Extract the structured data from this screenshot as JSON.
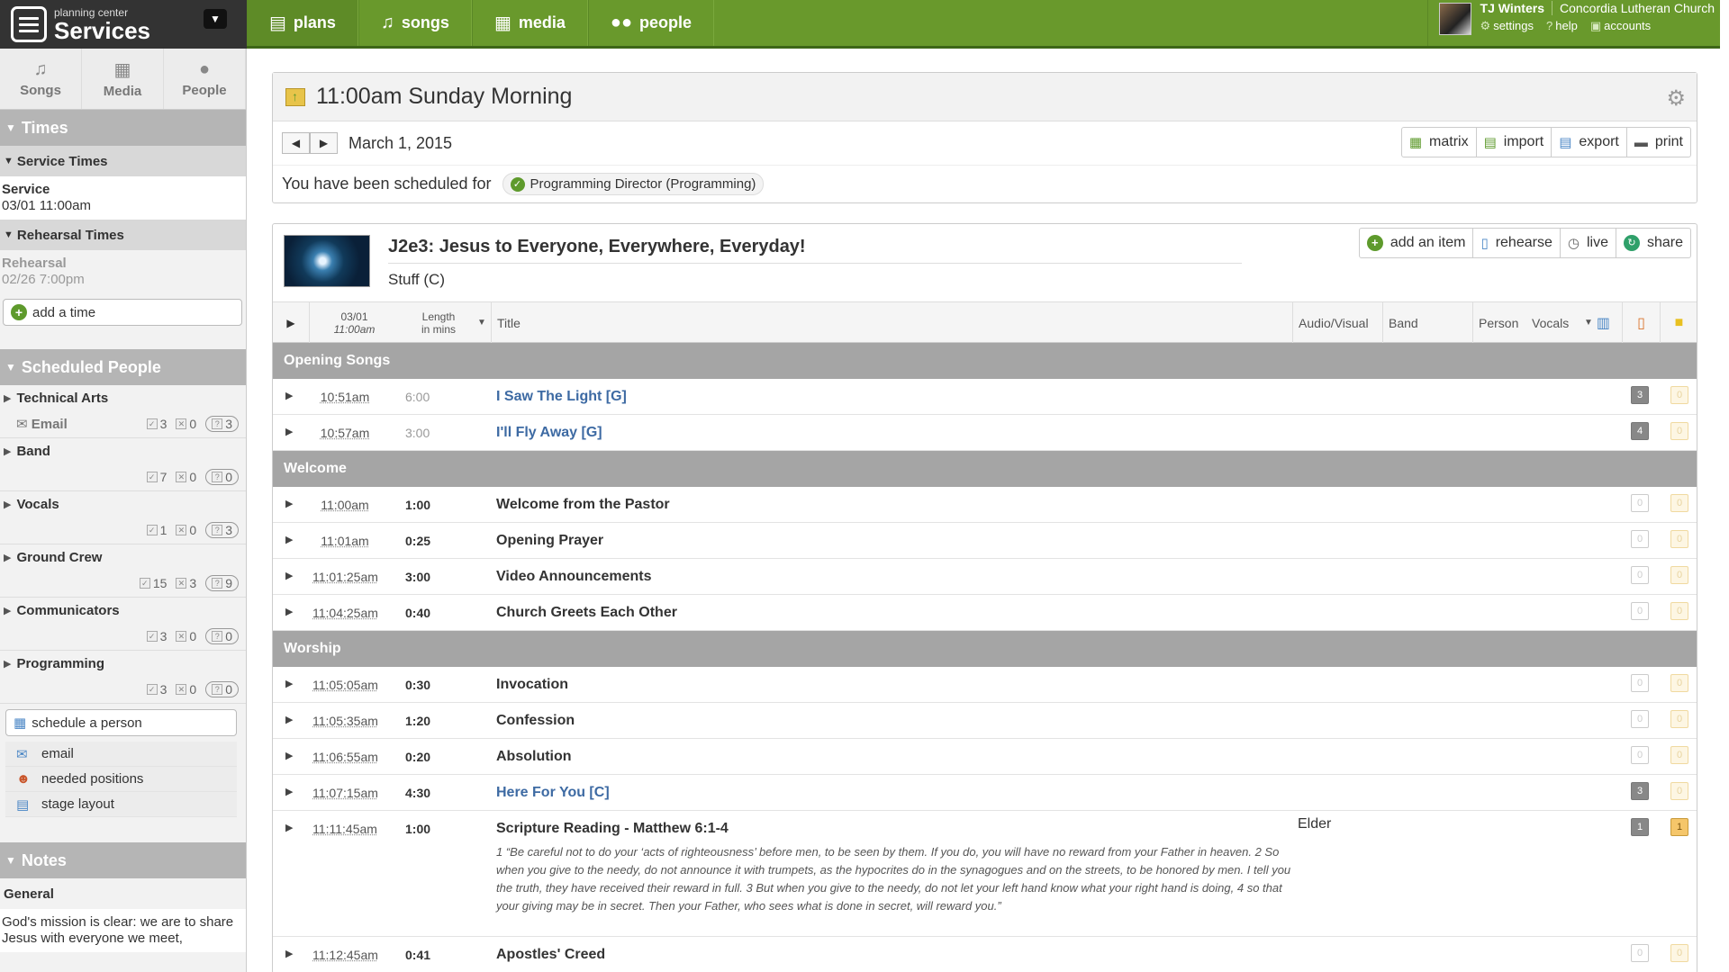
{
  "brand": {
    "small": "planning center",
    "name": "Services"
  },
  "nav": {
    "tabs": [
      {
        "label": "plans",
        "icon": "document-icon"
      },
      {
        "label": "songs",
        "icon": "music-note-icon"
      },
      {
        "label": "media",
        "icon": "film-icon"
      },
      {
        "label": "people",
        "icon": "people-icon"
      }
    ]
  },
  "user": {
    "name": "TJ Winters",
    "org": "Concordia Lutheran Church",
    "links": [
      "settings",
      "help",
      "accounts"
    ]
  },
  "sidebar": {
    "tabs": [
      "Songs",
      "Media",
      "People"
    ],
    "times": {
      "heading": "Times",
      "service_heading": "Service Times",
      "service_label": "Service",
      "service_time": "03/01 11:00am",
      "rehearsal_heading": "Rehearsal Times",
      "rehearsal_label": "Rehearsal",
      "rehearsal_time": "02/26 7:00pm",
      "add_time": "add a time"
    },
    "people": {
      "heading": "Scheduled People",
      "teams": [
        {
          "name": "Technical Arts",
          "email": "Email",
          "confirmed": "3",
          "declined": "0",
          "pending": "3"
        },
        {
          "name": "Band",
          "confirmed": "7",
          "declined": "0",
          "pending": "0"
        },
        {
          "name": "Vocals",
          "confirmed": "1",
          "declined": "0",
          "pending": "3"
        },
        {
          "name": "Ground Crew",
          "confirmed": "15",
          "declined": "3",
          "pending": "9"
        },
        {
          "name": "Communicators",
          "confirmed": "3",
          "declined": "0",
          "pending": "0"
        },
        {
          "name": "Programming",
          "confirmed": "3",
          "declined": "0",
          "pending": "0"
        }
      ],
      "schedule_btn": "schedule a person",
      "links": [
        "email",
        "needed positions",
        "stage layout"
      ]
    },
    "notes": {
      "heading": "Notes",
      "sub": "General",
      "text": "God's mission is clear:  we are to share Jesus with everyone we meet,"
    }
  },
  "plan": {
    "title": "11:00am Sunday Morning",
    "date": "March 1, 2015",
    "actions": [
      "matrix",
      "import",
      "export",
      "print"
    ],
    "scheduled_label": "You have been scheduled for",
    "scheduled_role": "Programming Director (Programming)"
  },
  "order": {
    "series_title": "J2e3: Jesus to Everyone, Everywhere, Everyday!",
    "key": "Stuff (C)",
    "actions": [
      "add an item",
      "rehearse",
      "live",
      "share"
    ],
    "columns": {
      "date": "03/01",
      "time": "11:00am",
      "length1": "Length",
      "length2": "in mins",
      "title": "Title",
      "av": "Audio/Visual",
      "band": "Band",
      "person": "Person",
      "vocals": "Vocals"
    },
    "sections": [
      {
        "name": "Opening Songs",
        "items": [
          {
            "time": "10:51am",
            "length": "6:00",
            "title": "I Saw The Light [G]",
            "song": true,
            "n1": "3",
            "n2": "0"
          },
          {
            "time": "10:57am",
            "length": "3:00",
            "title": "I'll Fly Away [G]",
            "song": true,
            "n1": "4",
            "n2": "0"
          }
        ]
      },
      {
        "name": "Welcome",
        "items": [
          {
            "time": "11:00am",
            "length": "1:00",
            "title": "Welcome from the Pastor",
            "n1": "0",
            "n2": "0"
          },
          {
            "time": "11:01am",
            "length": "0:25",
            "title": "Opening Prayer",
            "n1": "0",
            "n2": "0"
          },
          {
            "time": "11:01:25am",
            "length": "3:00",
            "title": "Video Announcements",
            "n1": "0",
            "n2": "0"
          },
          {
            "time": "11:04:25am",
            "length": "0:40",
            "title": "Church Greets Each Other",
            "n1": "0",
            "n2": "0"
          }
        ]
      },
      {
        "name": "Worship",
        "items": [
          {
            "time": "11:05:05am",
            "length": "0:30",
            "title": "Invocation",
            "n1": "0",
            "n2": "0"
          },
          {
            "time": "11:05:35am",
            "length": "1:20",
            "title": "Confession",
            "n1": "0",
            "n2": "0"
          },
          {
            "time": "11:06:55am",
            "length": "0:20",
            "title": "Absolution",
            "n1": "0",
            "n2": "0"
          },
          {
            "time": "11:07:15am",
            "length": "4:30",
            "title": "Here For You [C]",
            "song": true,
            "n1": "3",
            "n2": "0"
          },
          {
            "time": "11:11:45am",
            "length": "1:00",
            "title": "Scripture Reading - Matthew 6:1-4",
            "av": "Elder",
            "n1": "1",
            "n2": "1",
            "desc": "1 “Be careful not to do your ‘acts of righteousness’ before men, to be seen by them. If you do, you will have no reward from your Father in heaven. 2 So when you give to the needy, do not announce it with trumpets, as the hypocrites do in the synagogues and on the streets, to be honored by men. I tell you the truth, they have received their reward in full. 3 But when you give to the needy, do not let your left hand know what your right hand is doing, 4 so that your giving may be in secret. Then your Father, who sees what is done in secret, will reward you.”"
          },
          {
            "time": "11:12:45am",
            "length": "0:41",
            "title": "Apostles' Creed",
            "n1": "0",
            "n2": "0"
          }
        ]
      }
    ]
  }
}
